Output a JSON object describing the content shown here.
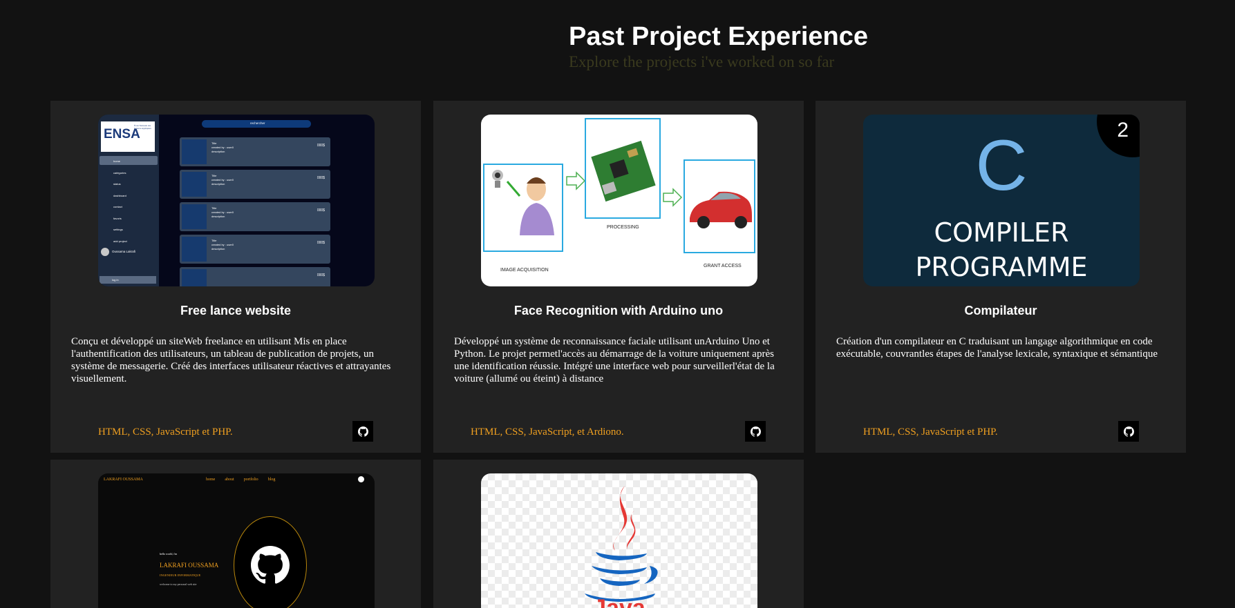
{
  "header": {
    "title": "Past Project Experience",
    "subtitle": "Explore the projects i've worked on so far"
  },
  "projects": [
    {
      "title": "Free lance website",
      "description": "Conçu et développé un siteWeb freelance en utilisant Mis en place l'authentification des utilisateurs, un tableau de publication de projets, un système de messagerie. Créé des interfaces utilisateur réactives et attrayantes visuellement.",
      "tech": "HTML, CSS, JavaScript et PHP.",
      "thumb": {
        "logo": "ENSA",
        "logo_sub": "École Nationale des Sciences Appliquées",
        "search": "rechercher",
        "menu": [
          "home",
          "catégories",
          "status",
          "dashboard",
          "contact",
          "favoris",
          "settings",
          "add project"
        ],
        "user": "Oussama Lakrafi",
        "logout": "log in",
        "post_title": "Title",
        "post_meta": "created by : user0",
        "post_desc": "description",
        "post_price": "000$"
      }
    },
    {
      "title": "Face Recognition with Arduino uno",
      "description": "Développé un système de reconnaissance faciale utilisant unArduino Uno et Python. Le projet permetl'accès au démarrage de la voiture uniquement après une identification réussie. Intégré une interface web pour surveillerl'état de la voiture (allumé ou éteint) à distance",
      "tech": "HTML, CSS, JavaScript, et Ardiono.",
      "thumb": {
        "label_acquisition": "IMAGE ACQUISITION",
        "label_processing": "PROCESSING",
        "label_access": "GRANT ACCESS"
      }
    },
    {
      "title": "Compilateur",
      "description": "Création d'un compilateur en C traduisant un langage algorithmique en code exécutable, couvrantles étapes de l'analyse lexicale, syntaxique et sémantique",
      "tech": "HTML, CSS, JavaScript et PHP.",
      "thumb": {
        "letter": "C",
        "line1": "COMPILER",
        "line2": "PROGRAMME",
        "badge": "2"
      }
    },
    {
      "title": "",
      "description": "",
      "tech": "",
      "thumb": {
        "brand": "LAKRAFI OUSSAMA",
        "nav": [
          "home",
          "about",
          "portfolio",
          "blog"
        ],
        "hello": "hello world, i'm",
        "name": "LAKRAFI OUSSAMA",
        "role": "INGENIEUR INFORMATIQUE",
        "tagline": "welcome to my personal web site"
      }
    },
    {
      "title": "",
      "description": "",
      "tech": "",
      "thumb": {
        "logo_text": "Java"
      }
    }
  ],
  "colors": {
    "background": "#121212",
    "card": "#222222",
    "accent": "#f0a020",
    "subtitle": "#3a3a1e"
  }
}
